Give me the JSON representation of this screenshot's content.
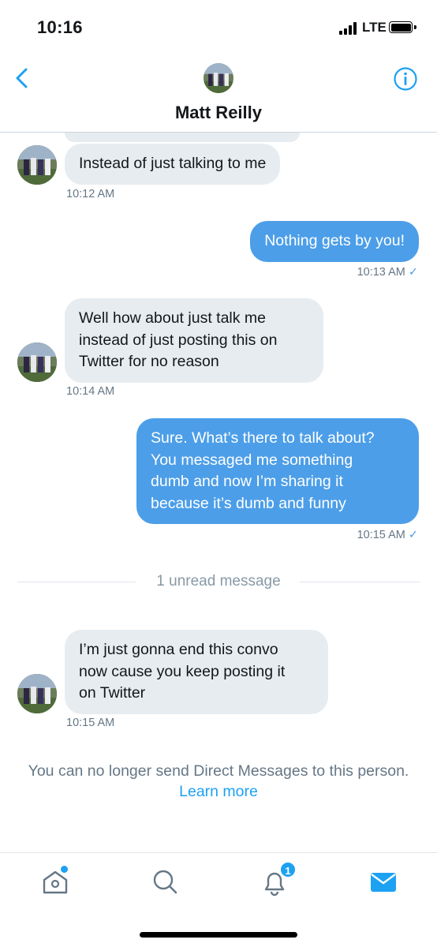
{
  "status_bar": {
    "time": "10:16",
    "network": "LTE"
  },
  "header": {
    "contact_name": "Matt Reilly",
    "back_icon": "chevron-left-icon",
    "info_icon": "info-icon"
  },
  "messages": [
    {
      "direction": "received",
      "text": "Instead of just talking to me",
      "time": "10:12 AM"
    },
    {
      "direction": "sent",
      "text": "Nothing gets by you!",
      "time": "10:13 AM",
      "status": "✓"
    },
    {
      "direction": "received",
      "lines": [
        "Well how about just talk me",
        "instead of just posting this on",
        "Twitter for no reason"
      ],
      "time": "10:14 AM"
    },
    {
      "direction": "sent",
      "lines": [
        "Sure. What’s there to talk about?",
        "You messaged me something",
        "dumb and now I’m sharing it",
        "because it’s dumb and funny"
      ],
      "time": "10:15 AM",
      "status": "✓"
    },
    {
      "direction": "received",
      "lines": [
        "I’m just gonna end this convo",
        "now cause you keep posting it",
        "on Twitter"
      ],
      "time": "10:15 AM"
    }
  ],
  "unread_divider": "1 unread message",
  "blocked_notice": {
    "text": "You can no longer send Direct Messages to this person.",
    "link": "Learn more"
  },
  "tab_bar": {
    "home_icon": "home-icon",
    "search_icon": "search-icon",
    "notifications_icon": "bell-icon",
    "notifications_count": "1",
    "messages_icon": "mail-icon"
  },
  "colors": {
    "accent": "#1da1f2",
    "sent_bubble": "#4c9ee8",
    "received_bubble": "#e6ecf0",
    "muted_text": "#657786"
  }
}
